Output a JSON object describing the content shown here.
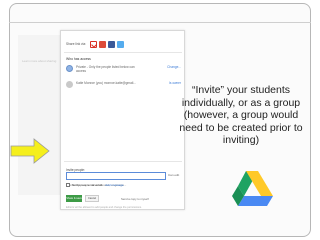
{
  "dialog": {
    "share_label": "Share link via:",
    "share_icons": [
      "gmail-icon",
      "google-plus-icon",
      "facebook-icon",
      "twitter-icon"
    ],
    "access_title": "Who has access",
    "rows": [
      {
        "icon": "globe-icon",
        "text": "Private - Only the people listed below can access",
        "action": "Change..."
      },
      {
        "icon": "person-icon",
        "text": "Katie Monroe (you)  monroe.katie@gmail...",
        "action": "Is owner"
      }
    ],
    "invite_label": "Invite people:",
    "invite_placeholder": "Enter names, email addresses, or groups...",
    "invite_permission": "Can edit",
    "notify_label": "Notify people via email",
    "notify_link": "Add message",
    "share_save_button": "Share & save",
    "cancel_button": "Cancel",
    "send_copy_label": "Send a copy to myself",
    "footer_note": "Editors will be allowed to add people and change the permissions."
  },
  "side_panel": {
    "link_text": "Learn more about sharing"
  },
  "annotation": "“Invite” your students individually, or as a group (however, a group would need to be created prior to inviting)",
  "colors": {
    "drive_green": "#1ea362",
    "drive_yellow": "#ffc928",
    "drive_blue": "#4a89f3",
    "arrow_yellow": "#f5ef1c"
  }
}
